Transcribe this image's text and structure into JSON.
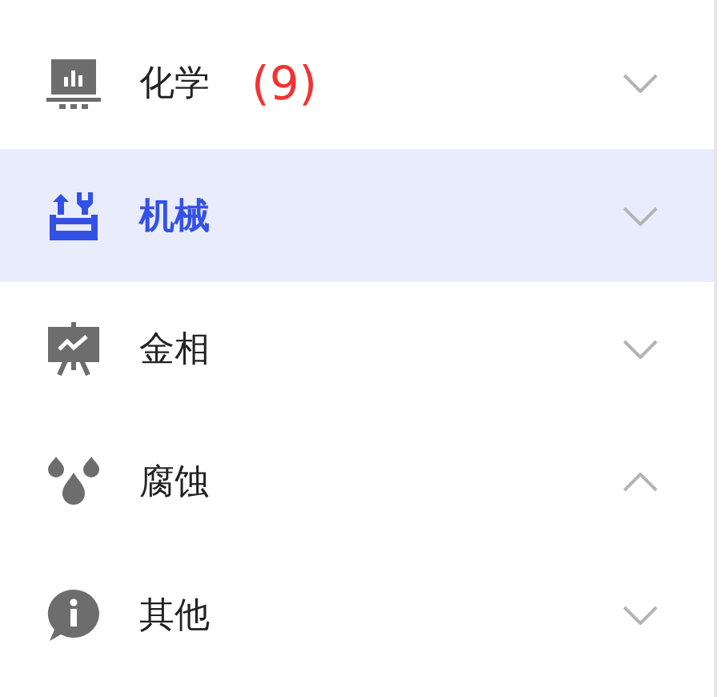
{
  "menu": {
    "items": [
      {
        "kind": "chemistry",
        "label": "化学",
        "count": "(9)",
        "selected": false,
        "expanded": false
      },
      {
        "kind": "mechanics",
        "label": "机械",
        "selected": true,
        "expanded": false
      },
      {
        "kind": "metallography",
        "label": "金相",
        "selected": false,
        "expanded": false
      },
      {
        "kind": "corrosion",
        "label": "腐蚀",
        "selected": false,
        "expanded": true
      },
      {
        "kind": "other",
        "label": "其他",
        "selected": false,
        "expanded": false
      }
    ]
  }
}
